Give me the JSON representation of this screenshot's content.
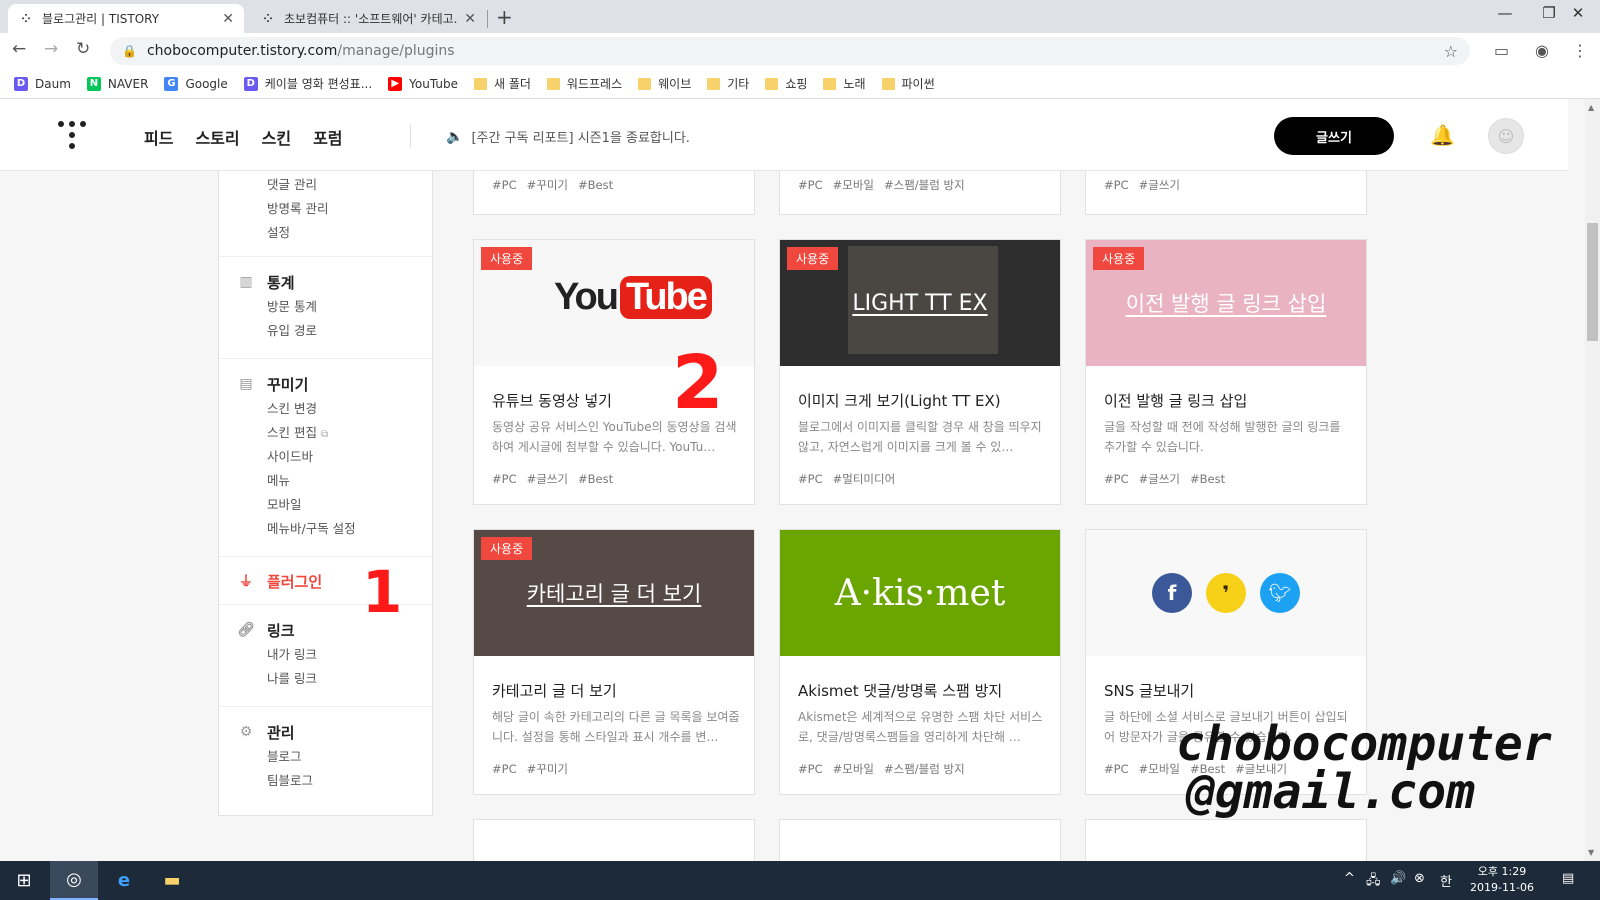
{
  "browser": {
    "tabs": [
      {
        "title": "블로그관리 | TISTORY"
      },
      {
        "title": "초보컴퓨터 :: '소프트웨어' 카테고..."
      }
    ],
    "url_host": "chobocomputer.tistory.com",
    "url_path": "/manage/plugins",
    "bookmarks": [
      {
        "label": "Daum",
        "color": "#6a5cf0",
        "letter": "D"
      },
      {
        "label": "NAVER",
        "color": "#03c75a",
        "letter": "N"
      },
      {
        "label": "Google",
        "color": "#4285f4",
        "letter": "G"
      },
      {
        "label": "케이블 영화 편성표...",
        "color": "#6a5cf0",
        "letter": "D"
      },
      {
        "label": "YouTube",
        "color": "#ff0000",
        "letter": "▶"
      },
      {
        "label": "새 폴더",
        "folder": true
      },
      {
        "label": "워드프레스",
        "folder": true
      },
      {
        "label": "웨이브",
        "folder": true
      },
      {
        "label": "기타",
        "folder": true
      },
      {
        "label": "쇼핑",
        "folder": true
      },
      {
        "label": "노래",
        "folder": true
      },
      {
        "label": "파이썬",
        "folder": true
      }
    ]
  },
  "header": {
    "nav": [
      "피드",
      "스토리",
      "스킨",
      "포럼"
    ],
    "notice": "[주간 구독 리포트] 시즌1을 종료합니다.",
    "write_label": "글쓰기"
  },
  "sidebar": {
    "top_items": [
      "댓글 관리",
      "방명록 관리",
      "설정"
    ],
    "stats": {
      "title": "통계",
      "items": [
        "방문 통계",
        "유입 경로"
      ]
    },
    "decorate": {
      "title": "꾸미기",
      "items": [
        "스킨 변경",
        "스킨 편집",
        "사이드바",
        "메뉴",
        "모바일",
        "메뉴바/구독 설정"
      ]
    },
    "plugin": {
      "title": "플러그인"
    },
    "link": {
      "title": "링크",
      "items": [
        "내가 링크",
        "나를 링크"
      ]
    },
    "manage": {
      "title": "관리",
      "items": [
        "블로그",
        "팀블로그"
      ]
    }
  },
  "top_row_tags": [
    [
      "#PC",
      "#꾸미기",
      "#Best"
    ],
    [
      "#PC",
      "#모바일",
      "#스팸/블럼 방지"
    ],
    [
      "#PC",
      "#글쓰기"
    ]
  ],
  "cards": [
    {
      "badge": "사용중",
      "name": "유튜브 동영상 넣기",
      "desc": "동영상 공유 서비스인 YouTube의 동영상을 검색하여 게시글에 첨부할 수 있습니다. YouTu…",
      "tags": [
        "#PC",
        "#글쓰기",
        "#Best"
      ],
      "thumb_text": "YouTube"
    },
    {
      "badge": "사용중",
      "name": "이미지 크게 보기(Light TT EX)",
      "desc": "블로그에서 이미지를 클릭할 경우 새 창을 띄우지 않고, 자연스럽게 이미지를 크게 볼 수 있…",
      "tags": [
        "#PC",
        "#멀티미디어"
      ],
      "thumb_text": "LIGHT TT EX"
    },
    {
      "badge": "사용중",
      "name": "이전 발행 글 링크 삽입",
      "desc": "글을 작성할 때 전에 작성해 발행한 글의 링크를 추가할 수 있습니다.",
      "tags": [
        "#PC",
        "#글쓰기",
        "#Best"
      ],
      "thumb_text": "이전 발행 글 링크 삽입"
    },
    {
      "badge": "사용중",
      "name": "카테고리 글 더 보기",
      "desc": "해당 글이 속한 카테고리의 다른 글 목록을 보여줍니다. 설정을 통해 스타일과 표시 개수를 변…",
      "tags": [
        "#PC",
        "#꾸미기"
      ],
      "thumb_text": "카테고리 글 더 보기"
    },
    {
      "badge": "",
      "name": "Akismet 댓글/방명록 스팸 방지",
      "desc": "Akismet은 세계적으로 유명한 스팸 차단 서비스로, 댓글/방명록스팸들을 영리하게 차단해 …",
      "tags": [
        "#PC",
        "#모바일",
        "#스팸/블럼 방지"
      ],
      "thumb_text": "A·kis·met"
    },
    {
      "badge": "",
      "name": "SNS 글보내기",
      "desc": "글 하단에 소셜 서비스로 글보내기 버튼이 삽입되어 방문자가 글을 공유할 수 있습니다.",
      "tags": [
        "#PC",
        "#모바일",
        "#Best",
        "#글보내기"
      ],
      "thumb_text": ""
    }
  ],
  "annotations": {
    "mark1": "1",
    "mark2": "2",
    "watermark_line1": "chobocomputer",
    "watermark_line2": "@gmail.com"
  },
  "taskbar": {
    "time": "오후 1:29",
    "date": "2019-11-06",
    "ime": "한"
  },
  "colors": {
    "accent": "#f0483e",
    "youtube_red": "#e62117",
    "akismet_green": "#6aa500",
    "facebook": "#3b5998",
    "kakao": "#f7d117",
    "twitter": "#1da1f2"
  }
}
